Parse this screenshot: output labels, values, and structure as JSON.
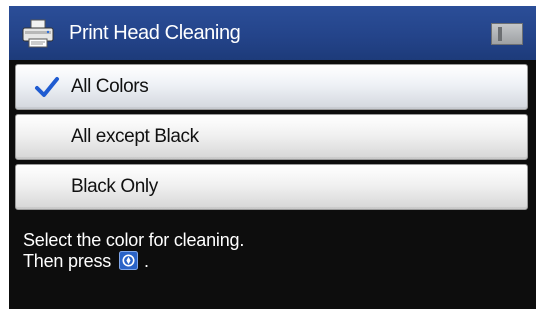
{
  "header": {
    "title": "Print Head Cleaning",
    "icon": "printer-icon",
    "status_icon": "memory-card-icon"
  },
  "options": [
    {
      "label": "All Colors",
      "selected": true,
      "icon": "checkmark-icon"
    },
    {
      "label": "All except Black",
      "selected": false
    },
    {
      "label": "Black Only",
      "selected": false
    }
  ],
  "message": {
    "line1": "Select the color for cleaning.",
    "line2_prefix": "Then press",
    "line2_suffix": ".",
    "button_icon": "ok-button-icon"
  },
  "colors": {
    "header_blue": "#24448a",
    "check_blue": "#1f5bd1",
    "screen_black": "#0d0d0d"
  }
}
